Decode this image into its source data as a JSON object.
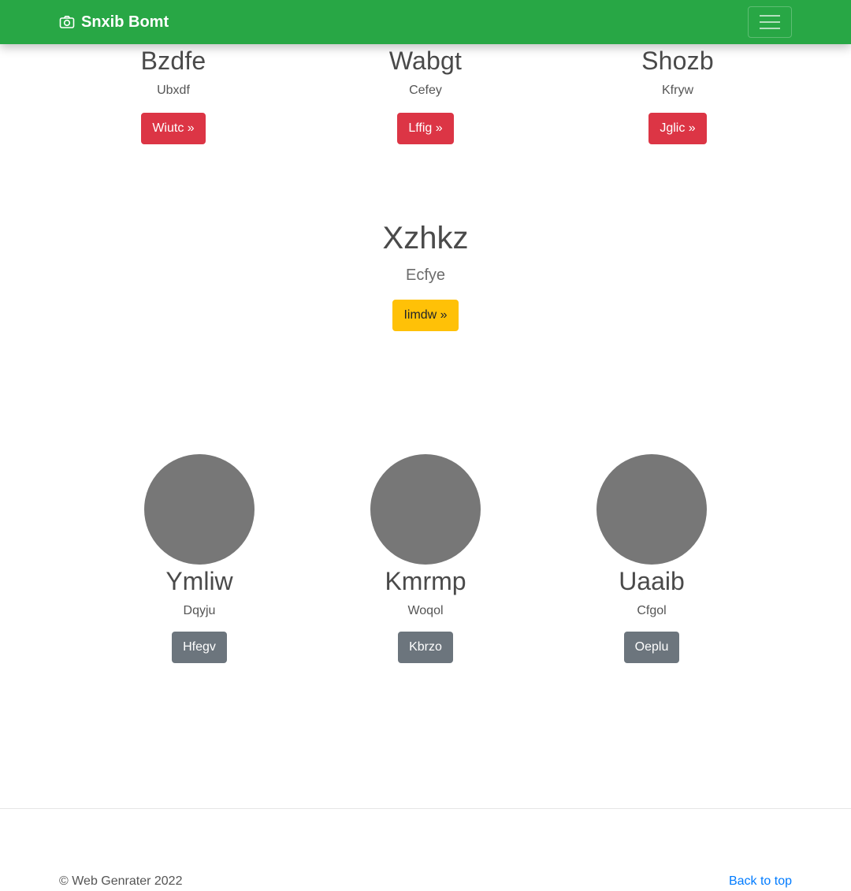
{
  "navbar": {
    "brand": "Snxib Bomt",
    "brand_icon": "camera-icon",
    "toggler_icon": "hamburger-icon"
  },
  "features": [
    {
      "title": "Bzdfe",
      "subtitle": "Ubxdf",
      "button": "Wiutc »"
    },
    {
      "title": "Wabgt",
      "subtitle": "Cefey",
      "button": "Lffig »"
    },
    {
      "title": "Shozb",
      "subtitle": "Kfryw",
      "button": "Jglic »"
    }
  ],
  "hero": {
    "title": "Xzhkz",
    "subtitle": "Ecfye",
    "button": "Iimdw »"
  },
  "people": [
    {
      "name": "Ymliw",
      "caption": "Dqyju",
      "button": "Hfegv"
    },
    {
      "name": "Kmrmp",
      "caption": "Woqol",
      "button": "Kbrzo"
    },
    {
      "name": "Uaaib",
      "caption": "Cfgol",
      "button": "Oeplu"
    }
  ],
  "footer": {
    "copyright": "© Web Genrater 2022",
    "back_to_top": "Back to top"
  },
  "colors": {
    "navbar": "#28a745",
    "danger": "#dc3545",
    "warning": "#ffc107",
    "secondary": "#6c757d",
    "avatar": "#777777",
    "link": "#007bff"
  }
}
